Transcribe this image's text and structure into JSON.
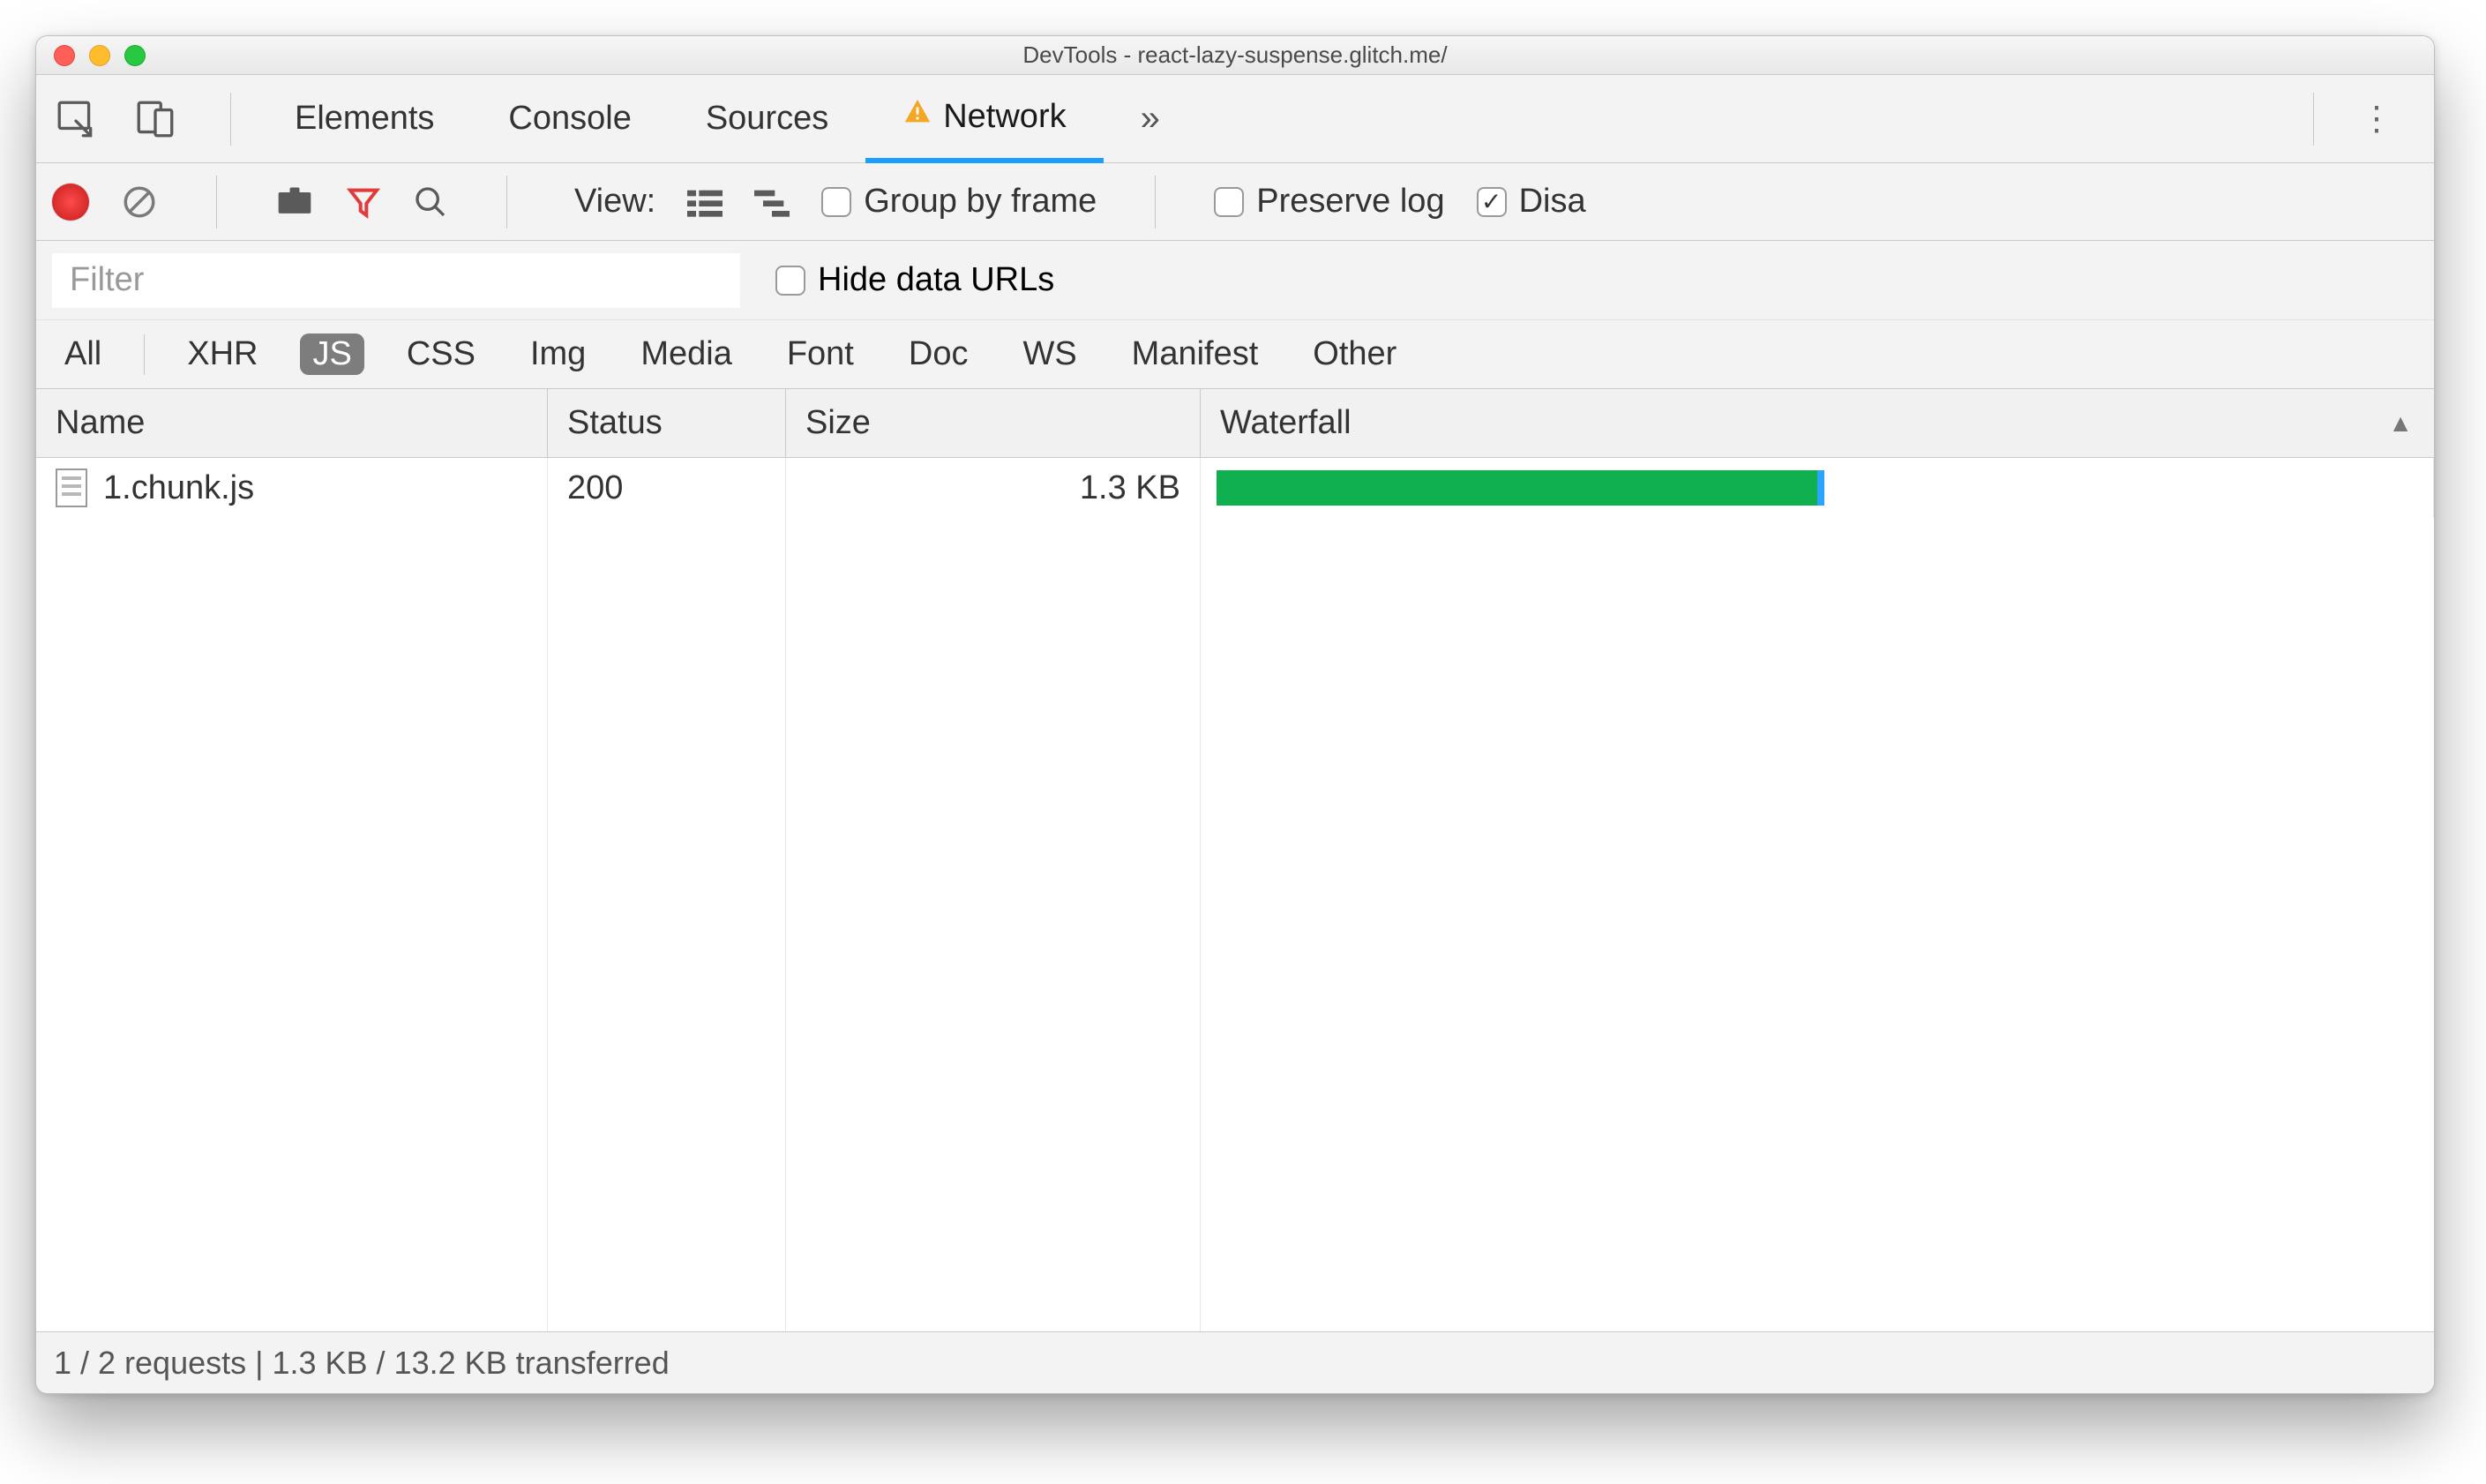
{
  "window": {
    "title": "DevTools - react-lazy-suspense.glitch.me/"
  },
  "tabs": {
    "items": [
      "Elements",
      "Console",
      "Sources",
      "Network"
    ],
    "active_index": 3,
    "warning_on_index": 3
  },
  "toolbar": {
    "view_label": "View:",
    "group_by_frame": {
      "label": "Group by frame",
      "checked": false
    },
    "preserve_log": {
      "label": "Preserve log",
      "checked": false
    },
    "disable_cache": {
      "label": "Disa",
      "checked": true
    }
  },
  "filter": {
    "placeholder": "Filter",
    "value": "",
    "hide_data_urls": {
      "label": "Hide data URLs",
      "checked": false
    }
  },
  "types": {
    "items": [
      "All",
      "XHR",
      "JS",
      "CSS",
      "Img",
      "Media",
      "Font",
      "Doc",
      "WS",
      "Manifest",
      "Other"
    ],
    "active_index": 2
  },
  "table": {
    "columns": [
      "Name",
      "Status",
      "Size",
      "Waterfall"
    ],
    "sorted_column_index": 3,
    "rows": [
      {
        "name": "1.chunk.js",
        "status": "200",
        "size": "1.3 KB",
        "waterfall_width_pct": 50
      }
    ]
  },
  "status": {
    "text": "1 / 2 requests | 1.3 KB / 13.2 KB transferred"
  }
}
